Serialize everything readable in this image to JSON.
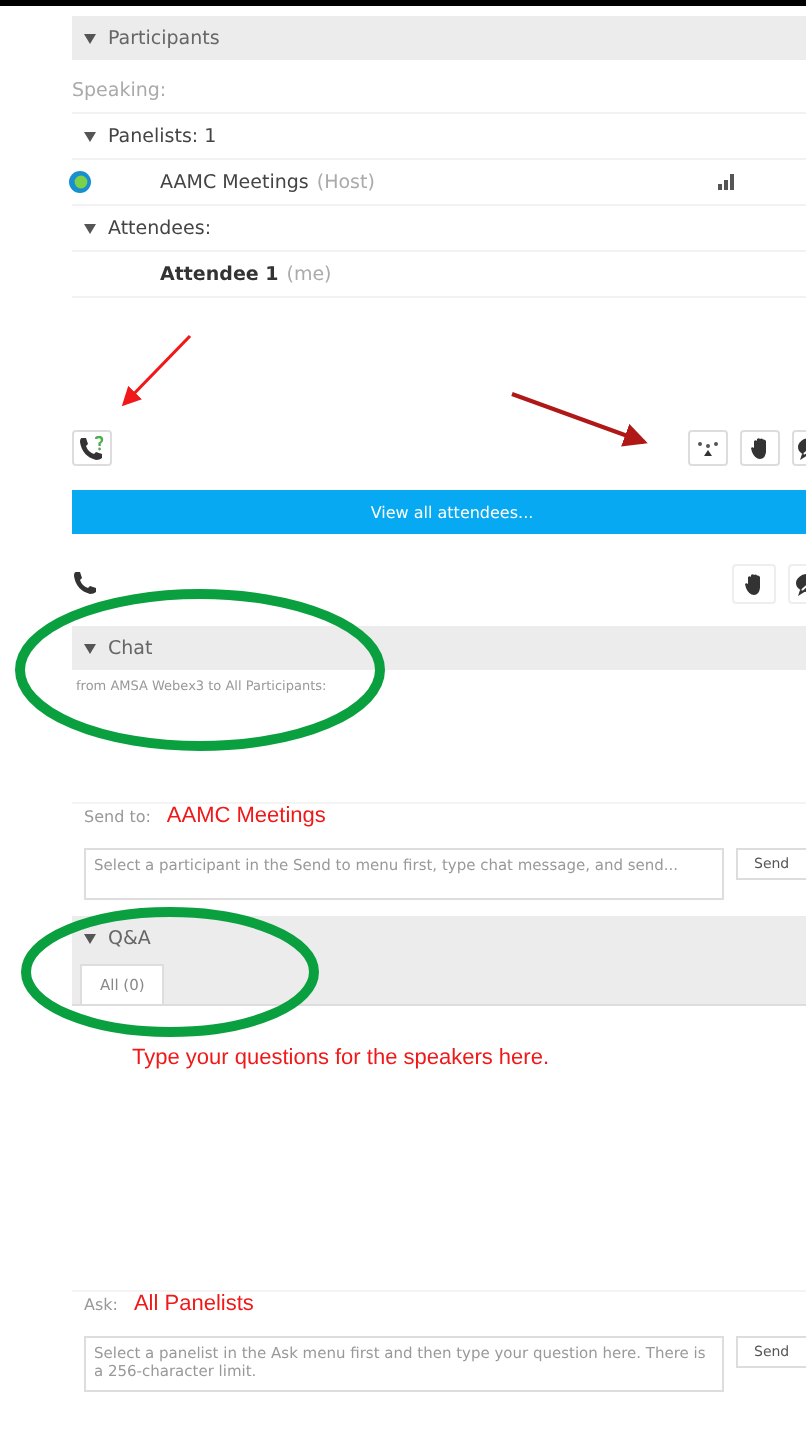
{
  "participants": {
    "title": "Participants",
    "expanded": true,
    "speaking_label": "Speaking:",
    "groups": [
      {
        "label": "Panelists: 1",
        "expanded": true,
        "members": [
          {
            "name": "AAMC Meetings",
            "role": "(Host)",
            "kind": "host"
          }
        ]
      },
      {
        "label": "Attendees:",
        "expanded": true,
        "members": [
          {
            "name": "Attendee 1",
            "role": "(me)",
            "kind": "self"
          }
        ]
      }
    ],
    "view_all": "View all attendees..."
  },
  "chat": {
    "title": "Chat",
    "expanded": true,
    "from_line": "from AMSA Webex3 to All Participants:",
    "send_to_label": "Send to:",
    "send_to_value": "AAMC Meetings",
    "placeholder": "Select a participant in the Send to menu first, type chat message, and send...",
    "send": "Send"
  },
  "qa": {
    "title": "Q&A",
    "expanded": true,
    "tabs": [
      {
        "label": "All (0)",
        "selected": true
      }
    ],
    "note": "Type your questions for the speakers here.",
    "ask_label": "Ask:",
    "ask_value": "All Panelists",
    "placeholder": "Select a panelist in the Ask menu first and then type your question here. There is a 256-character limit.",
    "send": "Send"
  }
}
